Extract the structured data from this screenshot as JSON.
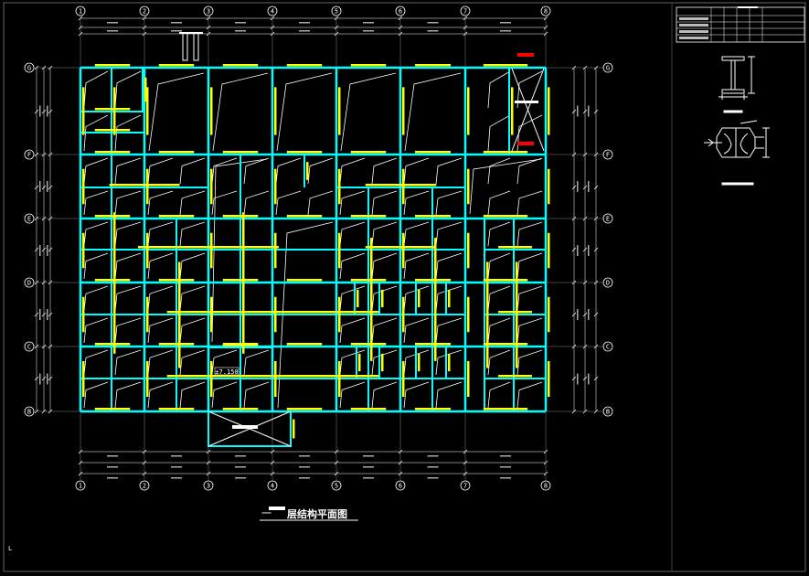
{
  "drawing": {
    "title_prefix": "一",
    "title_label": "层结构平面图",
    "elevation_tag": "±7.150",
    "corner_mark": "L"
  },
  "grid": {
    "columns": [
      "1",
      "2",
      "3",
      "4",
      "5",
      "6",
      "7",
      "8"
    ],
    "rows": [
      "G",
      "F",
      "E",
      "D",
      "C",
      "B"
    ]
  },
  "colors": {
    "background": "#000000",
    "beam": "#00ffff",
    "rebar_label": "#ffff00",
    "slab_line": "#ffffff",
    "marker": "#ff0000",
    "dimension": "#ffffff"
  },
  "legend_table": {
    "rows": [
      "",
      "",
      "",
      ""
    ]
  },
  "section_details": [
    {
      "name": "H-section column",
      "label": ""
    },
    {
      "name": "built-up box section",
      "label": ""
    }
  ]
}
